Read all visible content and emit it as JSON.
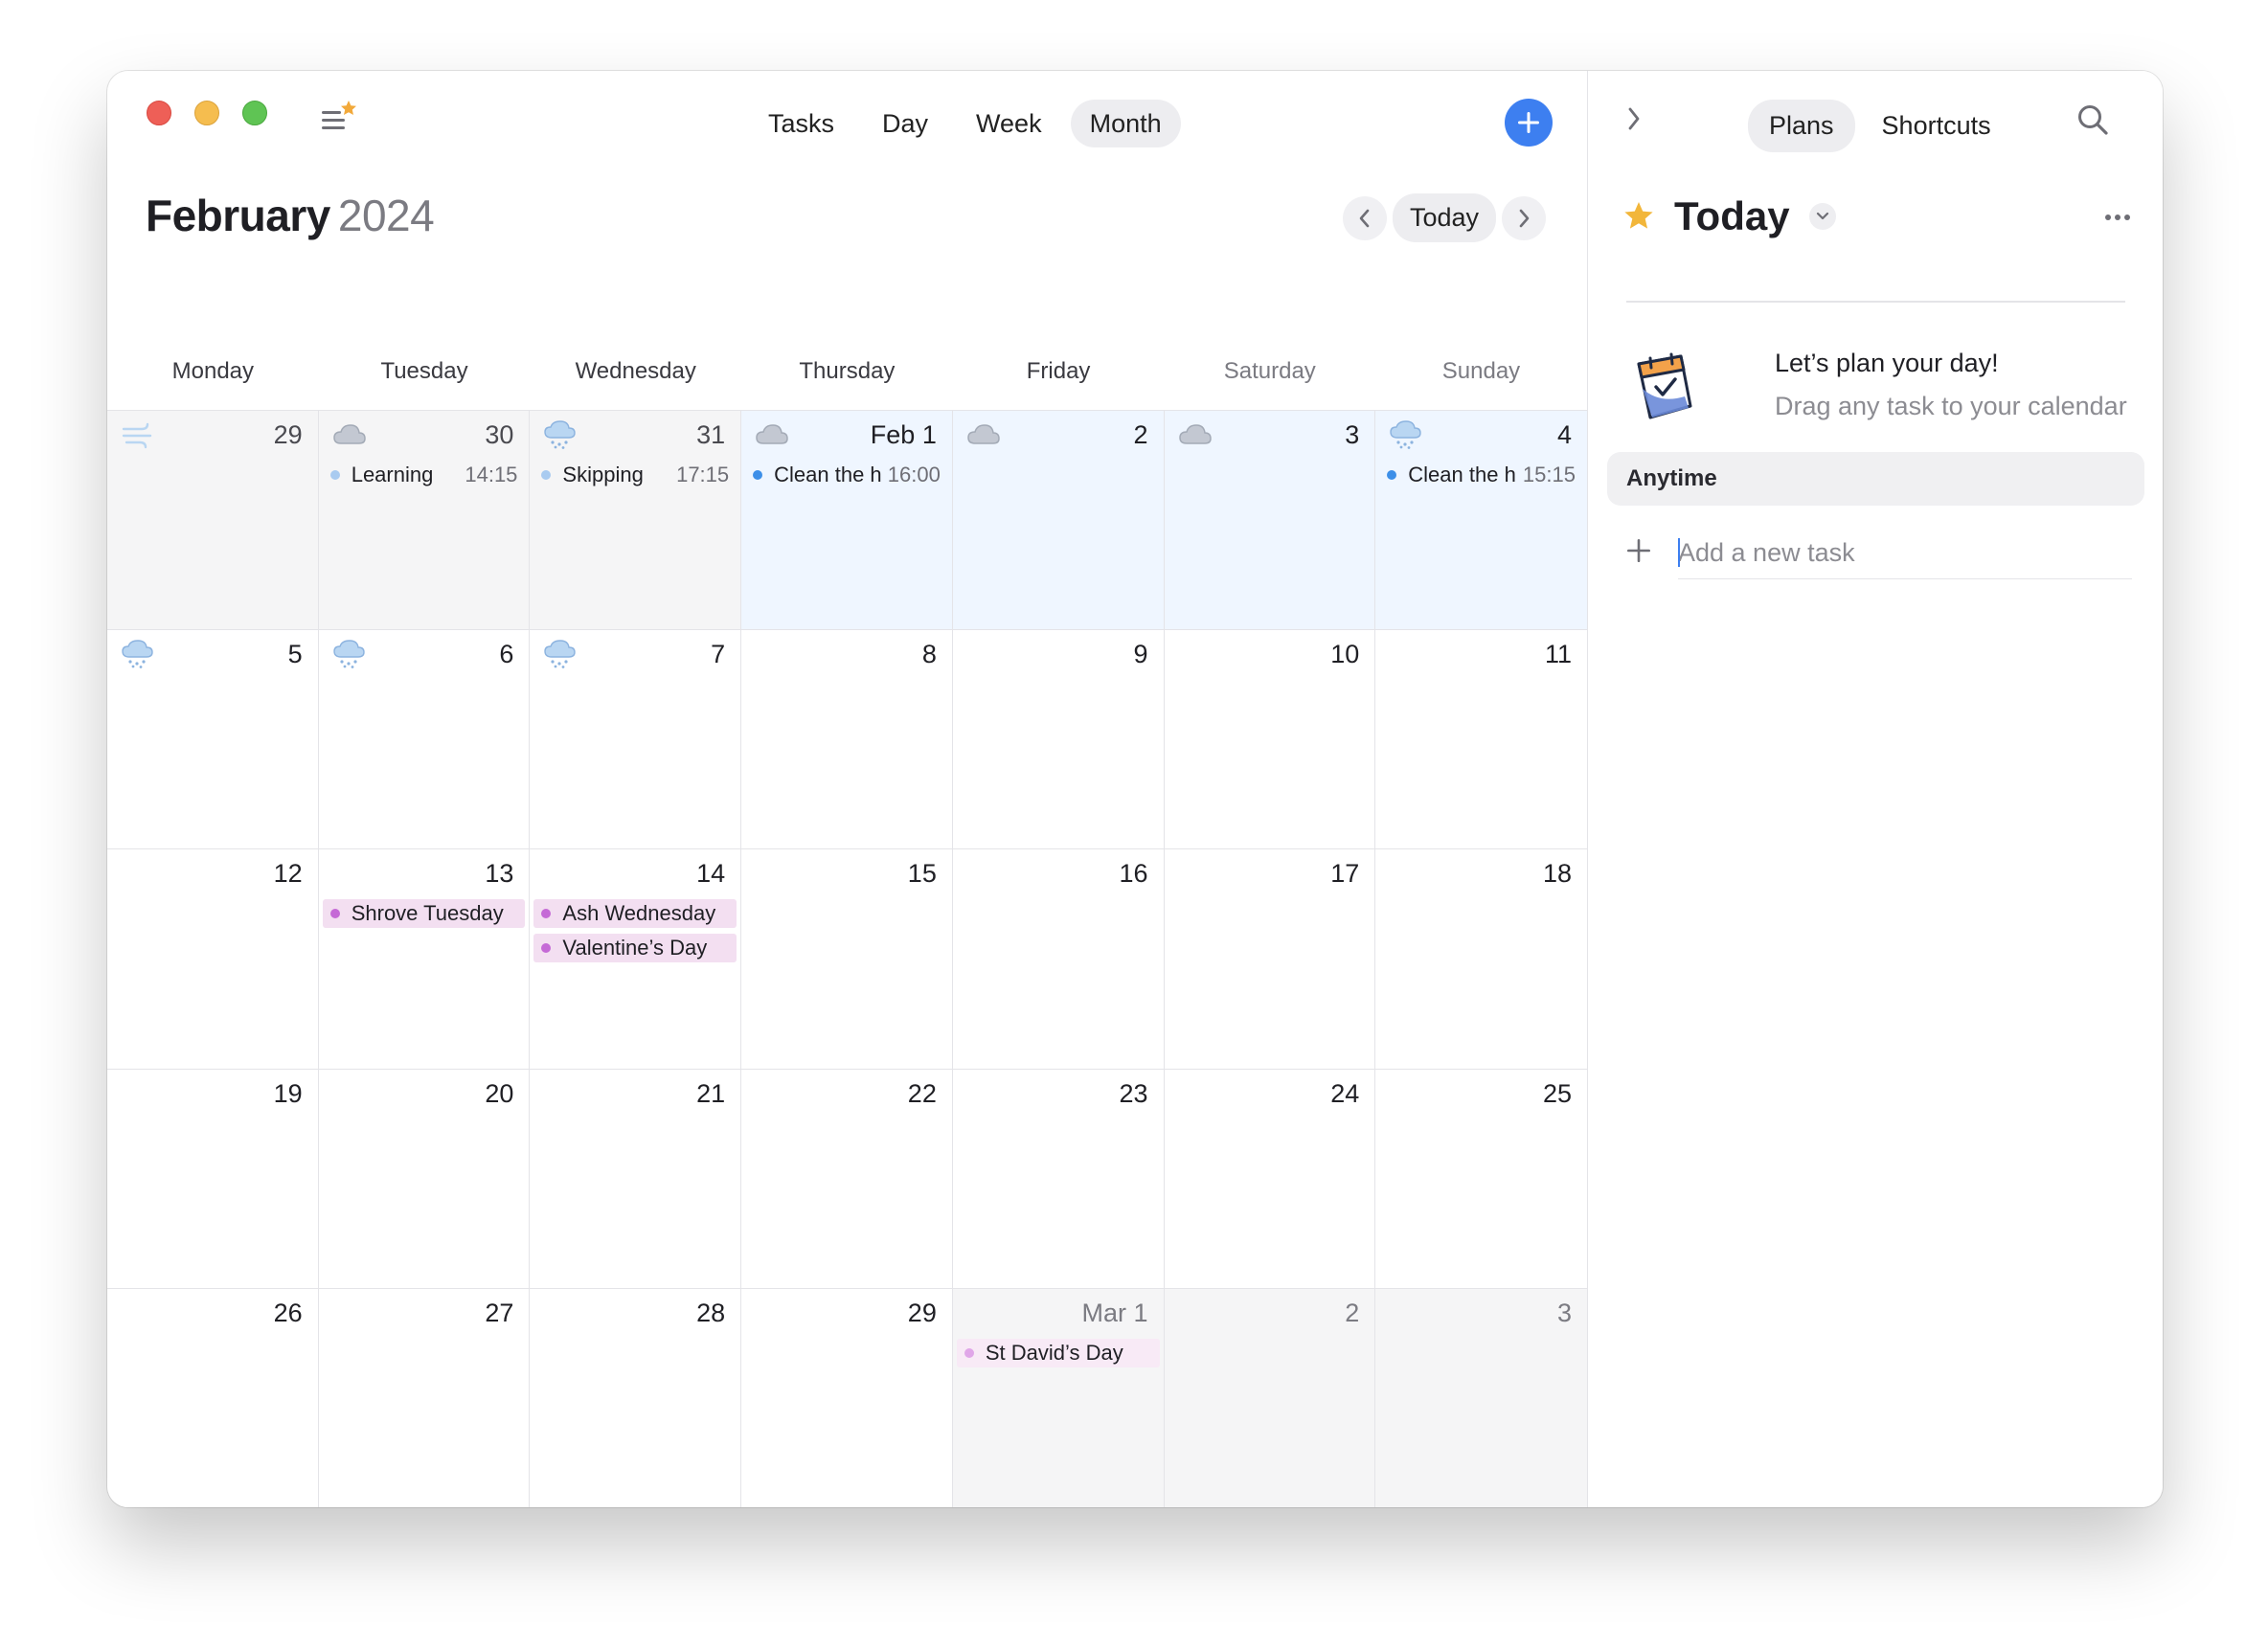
{
  "toolbar": {
    "tabs": [
      {
        "label": "Tasks",
        "active": false
      },
      {
        "label": "Day",
        "active": false
      },
      {
        "label": "Week",
        "active": false
      },
      {
        "label": "Month",
        "active": true
      }
    ],
    "add_icon": "plus-icon",
    "menu_icon": "list-star-icon"
  },
  "header": {
    "month": "February",
    "year": "2024",
    "today_label": "Today"
  },
  "weekdays": [
    "Monday",
    "Tuesday",
    "Wednesday",
    "Thursday",
    "Friday",
    "Saturday",
    "Sunday"
  ],
  "days": [
    {
      "label": "29",
      "state": "other",
      "weather": "wind",
      "events": []
    },
    {
      "label": "30",
      "state": "other",
      "weather": "cloud",
      "events": [
        {
          "title": "Learning",
          "time": "14:15",
          "dot": "#a9cbf0"
        }
      ]
    },
    {
      "label": "31",
      "state": "other",
      "weather": "snow",
      "events": [
        {
          "title": "Skipping",
          "time": "17:15",
          "dot": "#a9cbf0"
        }
      ]
    },
    {
      "label": "Feb 1",
      "state": "current",
      "weather": "cloud",
      "events": [
        {
          "title": "Clean the h",
          "time": "16:00",
          "dot": "#3d8fe8"
        }
      ]
    },
    {
      "label": "2",
      "state": "current",
      "weather": "cloud",
      "events": []
    },
    {
      "label": "3",
      "state": "current",
      "weather": "cloud",
      "events": []
    },
    {
      "label": "4",
      "state": "current",
      "weather": "snow",
      "events": [
        {
          "title": "Clean the h",
          "time": "15:15",
          "dot": "#3d8fe8"
        }
      ]
    },
    {
      "label": "5",
      "state": "normal",
      "weather": "snow",
      "events": []
    },
    {
      "label": "6",
      "state": "normal",
      "weather": "snow",
      "events": []
    },
    {
      "label": "7",
      "state": "normal",
      "weather": "snow",
      "events": []
    },
    {
      "label": "8",
      "state": "normal",
      "weather": "",
      "events": []
    },
    {
      "label": "9",
      "state": "normal",
      "weather": "",
      "events": []
    },
    {
      "label": "10",
      "state": "normal",
      "weather": "",
      "events": []
    },
    {
      "label": "11",
      "state": "normal",
      "weather": "",
      "events": []
    },
    {
      "label": "12",
      "state": "normal",
      "weather": "",
      "events": []
    },
    {
      "label": "13",
      "state": "normal",
      "weather": "",
      "events": [
        {
          "title": "Shrove Tuesday",
          "time": "",
          "dot": "#c56ad6",
          "holiday": true
        }
      ]
    },
    {
      "label": "14",
      "state": "normal",
      "weather": "",
      "events": [
        {
          "title": "Ash Wednesday",
          "time": "",
          "dot": "#c56ad6",
          "holiday": true
        },
        {
          "title": "Valentine’s Day",
          "time": "",
          "dot": "#c56ad6",
          "holiday": true
        }
      ]
    },
    {
      "label": "15",
      "state": "normal",
      "weather": "",
      "events": []
    },
    {
      "label": "16",
      "state": "normal",
      "weather": "",
      "events": []
    },
    {
      "label": "17",
      "state": "normal",
      "weather": "",
      "events": []
    },
    {
      "label": "18",
      "state": "normal",
      "weather": "",
      "events": []
    },
    {
      "label": "19",
      "state": "normal",
      "weather": "",
      "events": []
    },
    {
      "label": "20",
      "state": "normal",
      "weather": "",
      "events": []
    },
    {
      "label": "21",
      "state": "normal",
      "weather": "",
      "events": []
    },
    {
      "label": "22",
      "state": "normal",
      "weather": "",
      "events": []
    },
    {
      "label": "23",
      "state": "normal",
      "weather": "",
      "events": []
    },
    {
      "label": "24",
      "state": "normal",
      "weather": "",
      "events": []
    },
    {
      "label": "25",
      "state": "normal",
      "weather": "",
      "events": []
    },
    {
      "label": "26",
      "state": "normal",
      "weather": "",
      "events": []
    },
    {
      "label": "27",
      "state": "normal",
      "weather": "",
      "events": []
    },
    {
      "label": "28",
      "state": "normal",
      "weather": "",
      "events": []
    },
    {
      "label": "29",
      "state": "normal",
      "weather": "",
      "events": []
    },
    {
      "label": "Mar 1",
      "state": "other",
      "muted": true,
      "weather": "",
      "events": [
        {
          "title": "St David’s Day",
          "time": "",
          "dot": "#e0a6e8",
          "holiday": true,
          "light": true
        }
      ]
    },
    {
      "label": "2",
      "state": "other",
      "muted": true,
      "weather": "",
      "events": []
    },
    {
      "label": "3",
      "state": "other",
      "muted": true,
      "weather": "",
      "events": []
    }
  ],
  "sidebar": {
    "tabs": [
      {
        "label": "Plans",
        "active": true
      },
      {
        "label": "Shortcuts",
        "active": false
      }
    ],
    "title": "Today",
    "title_icon": "star-icon",
    "plan_title": "Let’s plan your day!",
    "plan_subtitle": "Drag any task to your calendar",
    "section": "Anytime",
    "add_task_placeholder": "Add a new task"
  },
  "colors": {
    "accent": "#3d7ff0",
    "star": "#f2b63a",
    "holiday_bg": "#f3dff1",
    "current_week_bg": "#eff6ff"
  }
}
